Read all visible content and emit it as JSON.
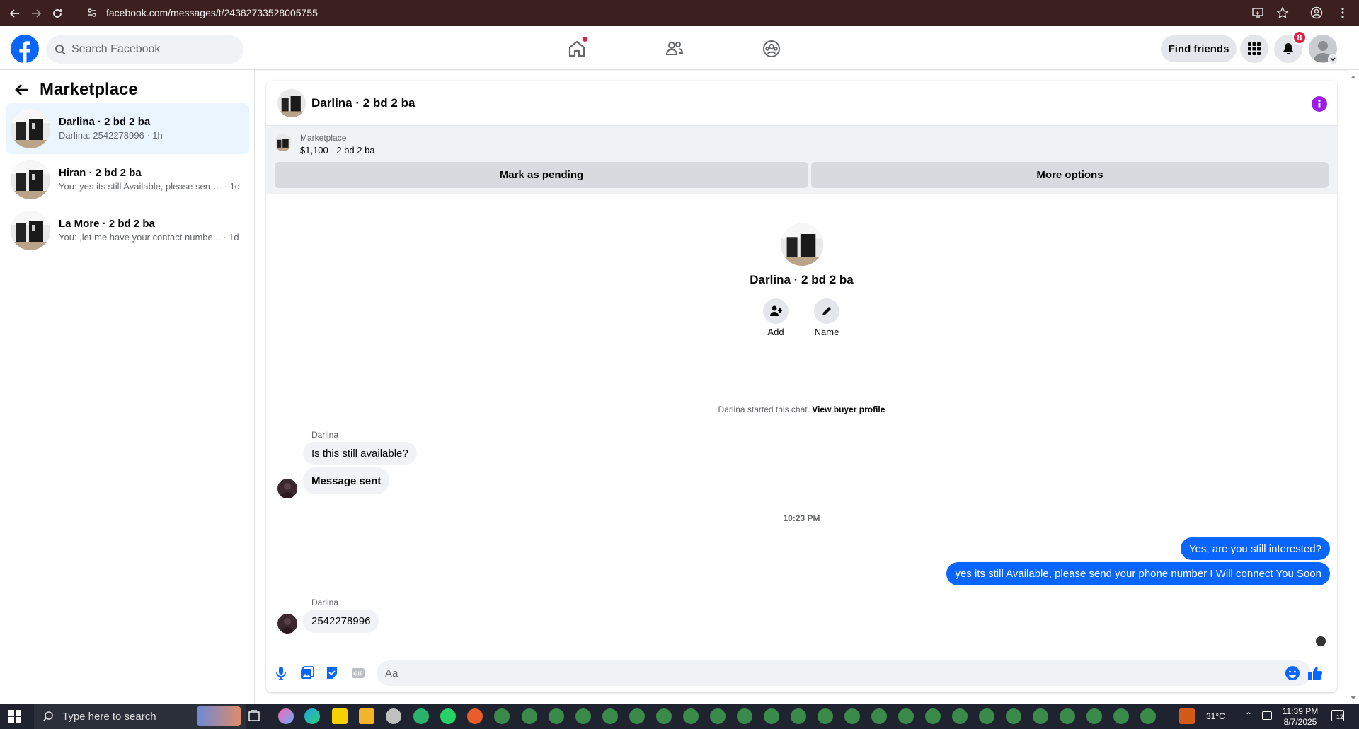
{
  "browser": {
    "url": "facebook.com/messages/t/24382733528005755"
  },
  "fb": {
    "search_placeholder": "Search Facebook",
    "find_friends": "Find friends",
    "notif_count": "8"
  },
  "sidebar": {
    "title": "Marketplace",
    "conversations": [
      {
        "name": "Darlina · 2 bd 2 ba",
        "preview": "Darlina: 2542278996",
        "time": "· 1h"
      },
      {
        "name": "Hiran · 2 bd 2 ba",
        "preview": "You: yes its still Available, please send ...",
        "time": "· 1d"
      },
      {
        "name": "La More · 2 bd 2 ba",
        "preview": "You: ,let me have your contact numbe...",
        "time": "· 1d"
      }
    ]
  },
  "chat": {
    "title": "Darlina · 2 bd 2 ba",
    "listing_source": "Marketplace",
    "listing": "$1,100 - 2 bd 2 ba",
    "mark_pending": "Mark as pending",
    "more_options": "More options",
    "profile_name": "Darlina · 2 bd 2 ba",
    "add_label": "Add",
    "name_label": "Name",
    "started_text": "Darlina started this chat.",
    "view_buyer": "View buyer profile",
    "messages": {
      "sender1": "Darlina",
      "m1": "Is this still available?",
      "m2": "Message sent",
      "timestamp": "10:23 PM",
      "m3": "Yes, are you still interested?",
      "m4": "yes its still Available, please send your phone number I Will connect You Soon",
      "sender2": "Darlina",
      "m5": "2542278996"
    },
    "composer_placeholder": "Aa"
  },
  "taskbar": {
    "search": "Type here to search",
    "temp": "31°C",
    "time": "11:39 PM",
    "date": "8/7/2025",
    "notif": "12"
  },
  "colors": {
    "fb_blue": "#0866ff",
    "chrome_frame": "#3c1f1f",
    "info_purple": "#9b1de6"
  }
}
